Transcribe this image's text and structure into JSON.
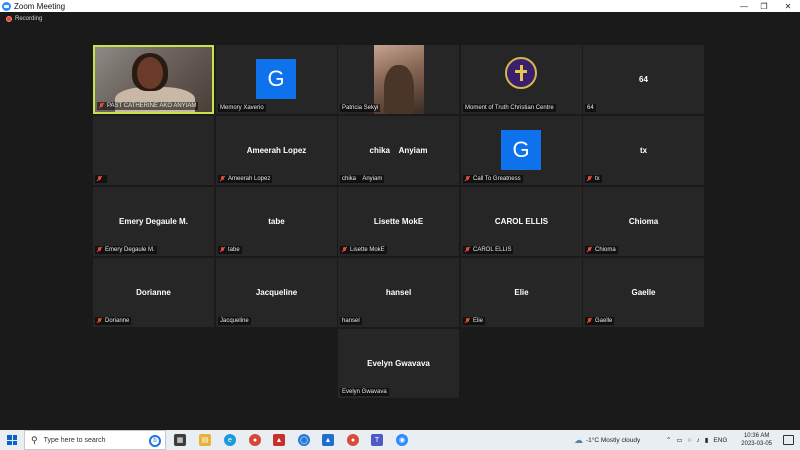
{
  "window": {
    "title": "Zoom Meeting"
  },
  "recording": {
    "label": "Recording"
  },
  "participants": [
    {
      "name": "PAST CATHERINE AKO ANYIAM",
      "center": "",
      "type": "video",
      "muted": true,
      "active": true
    },
    {
      "name": "Memory Xaverio",
      "center": "",
      "type": "avatar",
      "avatar_letter": "G",
      "muted": false
    },
    {
      "name": "Patricia Sekyi",
      "center": "",
      "type": "video2",
      "muted": false
    },
    {
      "name": "Moment of Truth Christian Centre",
      "center": "",
      "type": "logo",
      "muted": false
    },
    {
      "name": "64",
      "center": "64",
      "type": "name",
      "muted": false
    },
    {
      "name": "",
      "center": "",
      "type": "name",
      "muted": true
    },
    {
      "name": "Ameerah Lopez",
      "center": "Ameerah Lopez",
      "type": "name",
      "muted": true
    },
    {
      "name": "chika    Anyiam",
      "center": "chika    Anyiam",
      "type": "name",
      "muted": false
    },
    {
      "name": "Call To Greatness",
      "center": "",
      "type": "avatar",
      "avatar_letter": "G",
      "muted": true
    },
    {
      "name": "tx",
      "center": "tx",
      "type": "name",
      "muted": true
    },
    {
      "name": "Emery Degaule M.",
      "center": "Emery Degaule M.",
      "type": "name",
      "muted": true
    },
    {
      "name": "tabe",
      "center": "tabe",
      "type": "name",
      "muted": true
    },
    {
      "name": "Lisette MokE",
      "center": "Lisette MokE",
      "type": "name",
      "muted": true
    },
    {
      "name": "CAROL ELLIS",
      "center": "CAROL ELLIS",
      "type": "name",
      "muted": true
    },
    {
      "name": "Chioma",
      "center": "Chioma",
      "type": "name",
      "muted": true
    },
    {
      "name": "Dorianne",
      "center": "Dorianne",
      "type": "name",
      "muted": true
    },
    {
      "name": "Jacqueline",
      "center": "Jacqueline",
      "type": "name",
      "muted": false
    },
    {
      "name": "hansel",
      "center": "hansel",
      "type": "name",
      "muted": false
    },
    {
      "name": "Elie",
      "center": "Elie",
      "type": "name",
      "muted": true
    },
    {
      "name": "Gaelle",
      "center": "Gaelle",
      "type": "name",
      "muted": true
    },
    {
      "name": "Evelyn Gwavava",
      "center": "Evelyn Gwavava",
      "type": "name",
      "muted": false
    }
  ],
  "taskbar": {
    "search_placeholder": "Type here to search",
    "weather": "-1°C  Mostly cloudy",
    "language": "ENG",
    "time": "10:36 AM",
    "date": "2023-03-05"
  },
  "colors": {
    "active_border": "#c6e44a",
    "avatar_blue": "#0e72ed",
    "tile_bg": "#262626"
  }
}
